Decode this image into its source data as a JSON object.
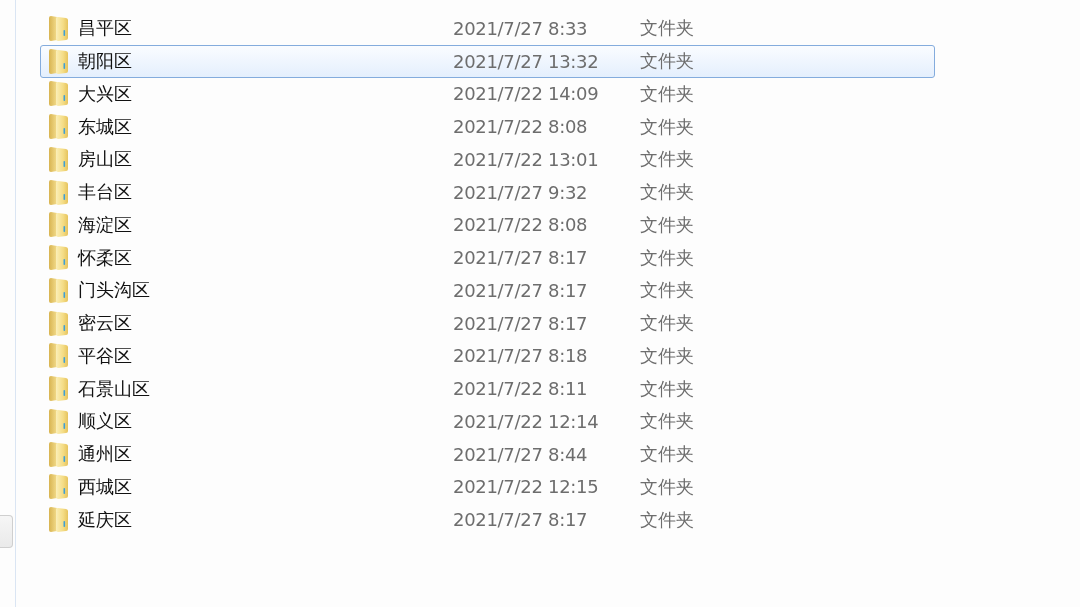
{
  "files": [
    {
      "name": "昌平区",
      "modified": "2021/7/27 8:33",
      "type": "文件夹",
      "selected": false
    },
    {
      "name": "朝阳区",
      "modified": "2021/7/27 13:32",
      "type": "文件夹",
      "selected": true
    },
    {
      "name": "大兴区",
      "modified": "2021/7/22 14:09",
      "type": "文件夹",
      "selected": false
    },
    {
      "name": "东城区",
      "modified": "2021/7/22 8:08",
      "type": "文件夹",
      "selected": false
    },
    {
      "name": "房山区",
      "modified": "2021/7/22 13:01",
      "type": "文件夹",
      "selected": false
    },
    {
      "name": "丰台区",
      "modified": "2021/7/27 9:32",
      "type": "文件夹",
      "selected": false
    },
    {
      "name": "海淀区",
      "modified": "2021/7/22 8:08",
      "type": "文件夹",
      "selected": false
    },
    {
      "name": "怀柔区",
      "modified": "2021/7/27 8:17",
      "type": "文件夹",
      "selected": false
    },
    {
      "name": "门头沟区",
      "modified": "2021/7/27 8:17",
      "type": "文件夹",
      "selected": false
    },
    {
      "name": "密云区",
      "modified": "2021/7/27 8:17",
      "type": "文件夹",
      "selected": false
    },
    {
      "name": "平谷区",
      "modified": "2021/7/27 8:18",
      "type": "文件夹",
      "selected": false
    },
    {
      "name": "石景山区",
      "modified": "2021/7/22 8:11",
      "type": "文件夹",
      "selected": false
    },
    {
      "name": "顺义区",
      "modified": "2021/7/22 12:14",
      "type": "文件夹",
      "selected": false
    },
    {
      "name": "通州区",
      "modified": "2021/7/27 8:44",
      "type": "文件夹",
      "selected": false
    },
    {
      "name": "西城区",
      "modified": "2021/7/22 12:15",
      "type": "文件夹",
      "selected": false
    },
    {
      "name": "延庆区",
      "modified": "2021/7/27 8:17",
      "type": "文件夹",
      "selected": false
    }
  ]
}
